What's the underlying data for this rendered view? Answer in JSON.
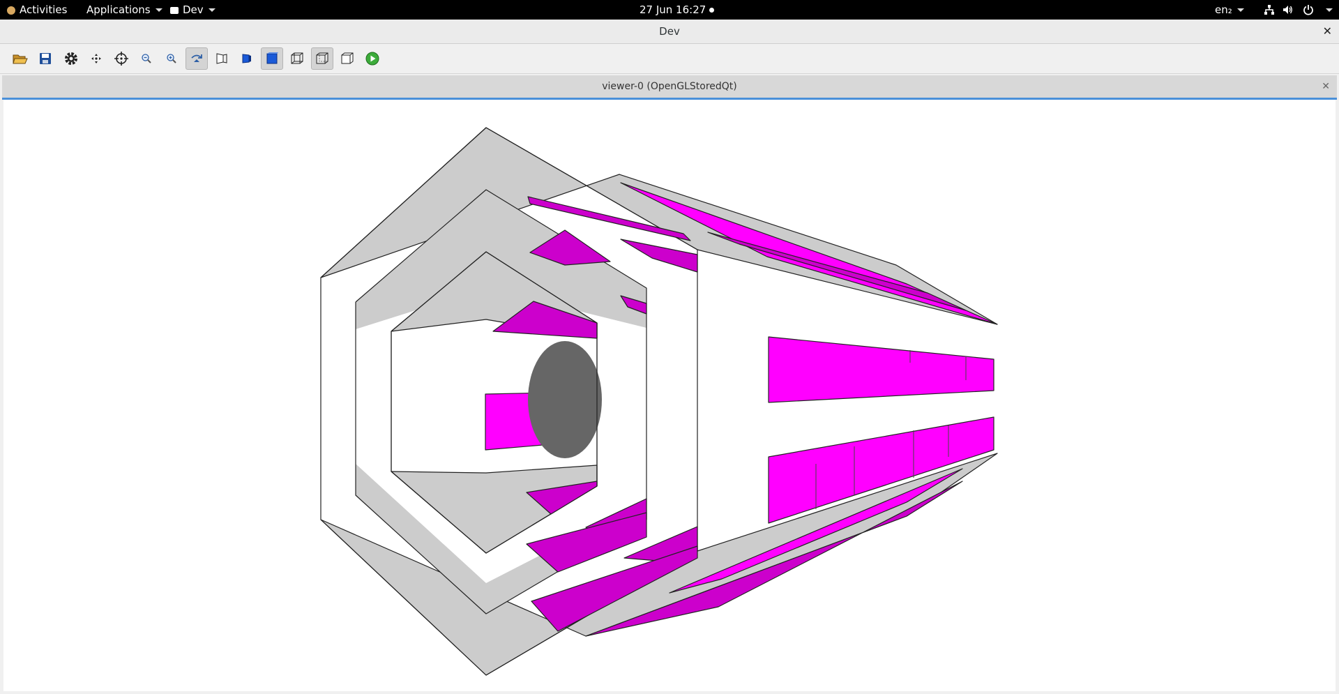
{
  "topbar": {
    "activities": "Activities",
    "applications": "Applications",
    "app_menu": "Dev",
    "clock": "27 Jun  16:27",
    "input_method": "en₂",
    "icons": [
      "network-icon",
      "volume-icon",
      "power-icon"
    ]
  },
  "window": {
    "title": "Dev",
    "close_glyph": "✕"
  },
  "toolbar": {
    "buttons": [
      {
        "name": "open-file-icon",
        "active": false
      },
      {
        "name": "save-icon",
        "active": false
      },
      {
        "name": "settings-icon",
        "active": false
      },
      {
        "name": "move-icon",
        "active": false
      },
      {
        "name": "pick-target-icon",
        "active": false
      },
      {
        "name": "zoom-out-icon",
        "active": false
      },
      {
        "name": "zoom-in-icon",
        "active": false
      },
      {
        "name": "rotate-icon",
        "active": true
      },
      {
        "name": "perspective-icon",
        "active": false
      },
      {
        "name": "solid-icon",
        "active": false
      },
      {
        "name": "solid-filled-icon",
        "active": true
      },
      {
        "name": "wireframe-icon",
        "active": false
      },
      {
        "name": "hidden-line-icon",
        "active": true
      },
      {
        "name": "hidden-line-removal-icon",
        "active": false
      },
      {
        "name": "run-icon",
        "active": false
      }
    ]
  },
  "viewer": {
    "title": "viewer-0 (OpenGLStoredQt)",
    "close_glyph": "✕",
    "colors": {
      "background": "#ffffff",
      "gray_surface": "#cccccc",
      "magenta": "#ff00ff",
      "dark_magenta": "#cc00cc",
      "disk": "#666666",
      "edge": "#222222"
    }
  }
}
